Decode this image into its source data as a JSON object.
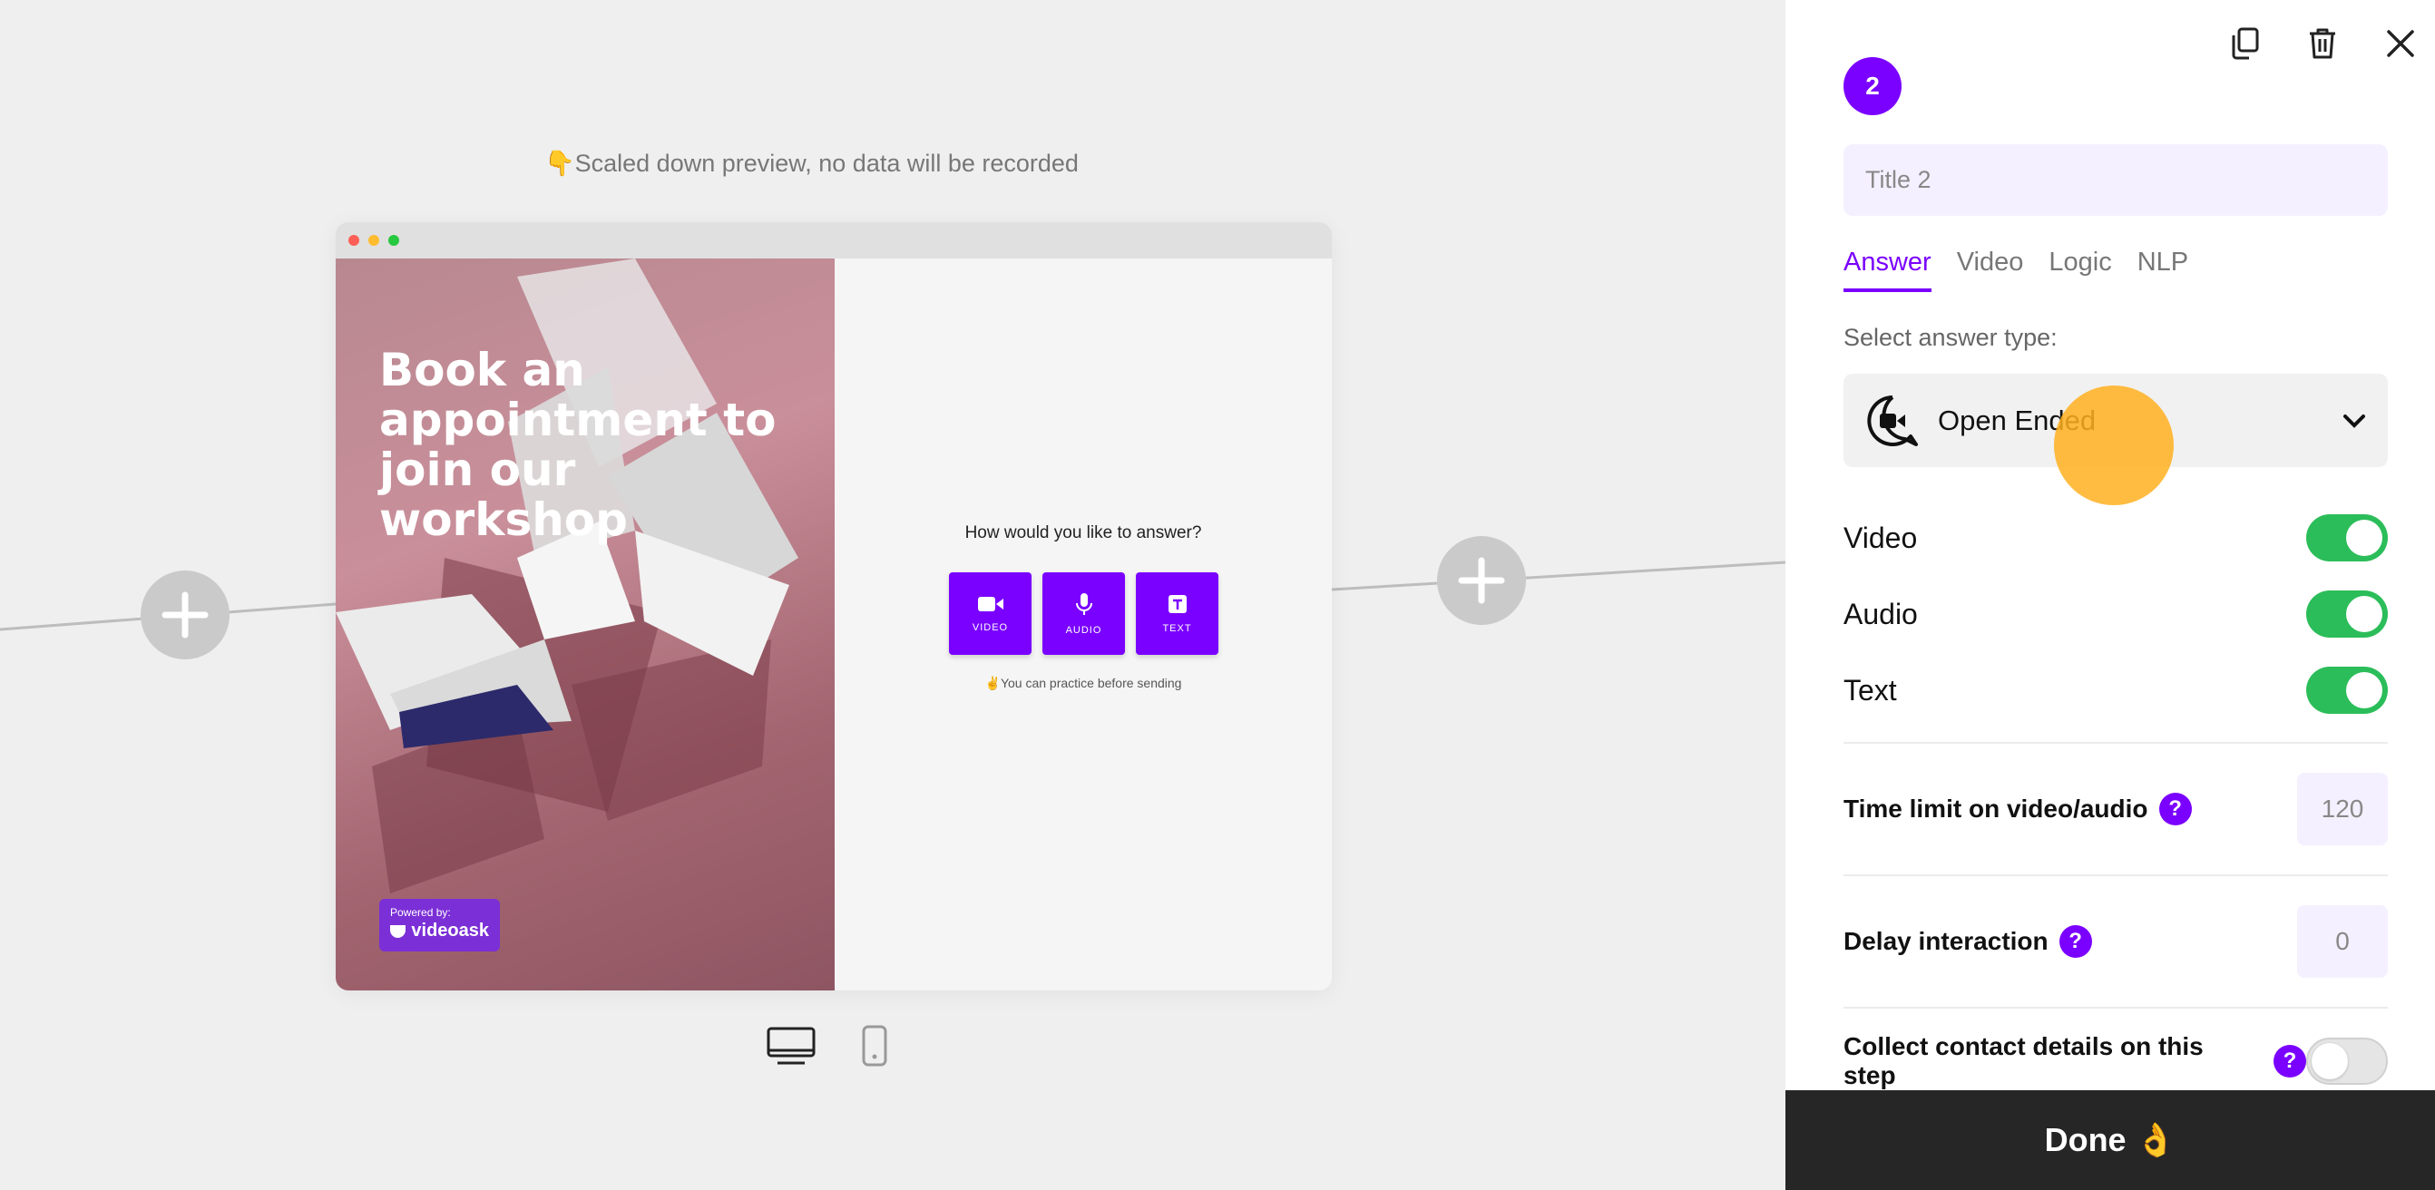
{
  "canvas": {
    "preview_note": "👇Scaled down preview, no data will be recorded",
    "preview": {
      "headline": "Book an appointment to join our workshop",
      "powered_by": "Powered by:",
      "brand": "videoask",
      "question": "How would you like to answer?",
      "buttons": [
        {
          "label": "VIDEO",
          "icon": "video-camera-icon"
        },
        {
          "label": "AUDIO",
          "icon": "microphone-icon"
        },
        {
          "label": "TEXT",
          "icon": "text-t-icon"
        }
      ],
      "practice_note": "✌️You can practice before sending"
    },
    "device_switch": [
      {
        "name": "desktop",
        "icon": "desktop-monitor-icon",
        "active": true
      },
      {
        "name": "mobile",
        "icon": "mobile-phone-icon",
        "active": false
      }
    ]
  },
  "panel": {
    "step_number": "2",
    "title_placeholder": "Title 2",
    "tabs": [
      "Answer",
      "Video",
      "Logic",
      "NLP"
    ],
    "active_tab": "Answer",
    "answer_type_label": "Select answer type:",
    "answer_type_value": "Open Ended",
    "toggles": [
      {
        "label": "Video",
        "on": true
      },
      {
        "label": "Audio",
        "on": true
      },
      {
        "label": "Text",
        "on": true
      }
    ],
    "time_limit_label": "Time limit on video/audio",
    "time_limit_value": "120",
    "delay_label": "Delay interaction",
    "delay_value": "0",
    "collect_contact_label": "Collect contact details on this step",
    "collect_contact_on": false,
    "help_glyph": "?",
    "done_label": "Done 👌"
  },
  "colors": {
    "accent": "#7a00ff",
    "toggle_on": "#2bbd59",
    "done_bg": "#262626",
    "cursor_highlight": "#ffb020"
  }
}
